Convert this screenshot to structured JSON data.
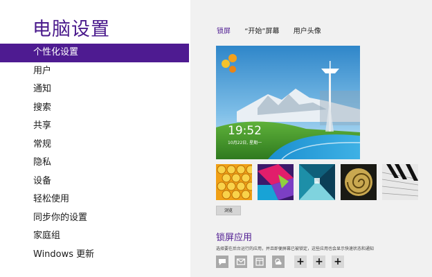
{
  "window": {
    "title": "电脑设置"
  },
  "sidebar": {
    "items": [
      {
        "label": "个性化设置",
        "active": true
      },
      {
        "label": "用户",
        "active": false
      },
      {
        "label": "通知",
        "active": false
      },
      {
        "label": "搜索",
        "active": false
      },
      {
        "label": "共享",
        "active": false
      },
      {
        "label": "常规",
        "active": false
      },
      {
        "label": "隐私",
        "active": false
      },
      {
        "label": "设备",
        "active": false
      },
      {
        "label": "轻松使用",
        "active": false
      },
      {
        "label": "同步你的设置",
        "active": false
      },
      {
        "label": "家庭组",
        "active": false
      },
      {
        "label": "Windows 更新",
        "active": false
      }
    ]
  },
  "tabs": [
    {
      "label": "锁屏",
      "active": true
    },
    {
      "label": "“开始”屏幕",
      "active": false
    },
    {
      "label": "用户头像",
      "active": false
    }
  ],
  "lock_screen": {
    "time": "19:52",
    "date": "10月22日, 星期一"
  },
  "browse_label": "浏览",
  "lock_apps": {
    "heading": "锁屏应用",
    "description": "选择要在后台运行的应用，并且即便屏幕已被锁定，这些应用也会显示快速状态和通知",
    "slots": [
      {
        "icon": "speech-bubble-icon"
      },
      {
        "icon": "mail-icon"
      },
      {
        "icon": "calendar-icon"
      },
      {
        "icon": "weather-icon"
      },
      {
        "icon": "add-icon",
        "symbol": "+"
      },
      {
        "icon": "add-icon",
        "symbol": "+"
      },
      {
        "icon": "add-icon",
        "symbol": "+"
      }
    ]
  },
  "colors": {
    "accent": "#4e1b91",
    "title": "#4a1a8c",
    "content_bg": "#f1f1f1"
  }
}
